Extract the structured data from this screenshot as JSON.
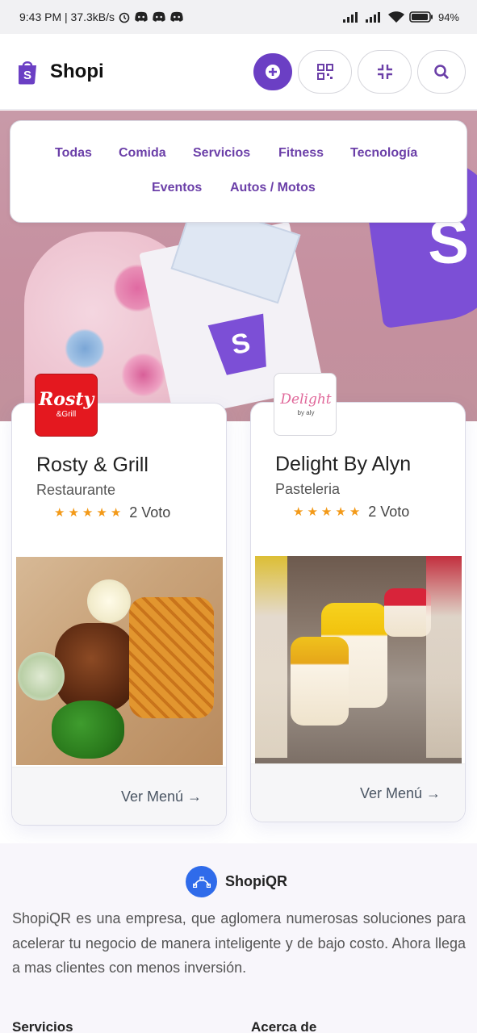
{
  "status_bar": {
    "time_speed": "9:43 PM | 37.3kB/s",
    "battery": "94%",
    "icons": [
      "alarm-icon",
      "discord-icon",
      "discord-icon",
      "discord-icon",
      "signal-icon",
      "signal-icon",
      "wifi-icon",
      "battery-icon"
    ]
  },
  "header": {
    "brand": "Shopi",
    "buttons": [
      "plus-circle-icon",
      "qr-code-icon",
      "minimize-icon",
      "search-icon"
    ]
  },
  "categories": [
    "Todas",
    "Comida",
    "Servicios",
    "Fitness",
    "Tecnología",
    "Eventos",
    "Autos /  Motos"
  ],
  "hero": {
    "logo_letter": "S"
  },
  "cards": [
    {
      "title": "Rosty & Grill",
      "subtitle": "Restaurante",
      "rating": 5,
      "votes": "2 Voto",
      "logo_text": "Rosty",
      "logo_sub": "&Grill",
      "action": "Ver Menú →"
    },
    {
      "title": "Delight By Alyn",
      "subtitle": "Pasteleria",
      "rating": 5,
      "votes": "2 Voto",
      "logo_text": "Delight",
      "logo_sub": "by aly",
      "action": "Ver Menú →"
    }
  ],
  "about": {
    "name": "ShopiQR",
    "text": "ShopiQR es una empresa, que aglomera numerosas soluciones para acelerar tu negocio de manera inteligente y de bajo costo. Ahora llega a mas clientes con menos inversión.",
    "col1": "Servicios",
    "col2": "Acerca de"
  },
  "colors": {
    "brand_purple": "#6b3fc4",
    "star": "#f39a19",
    "link_blue": "#2f6bea"
  }
}
